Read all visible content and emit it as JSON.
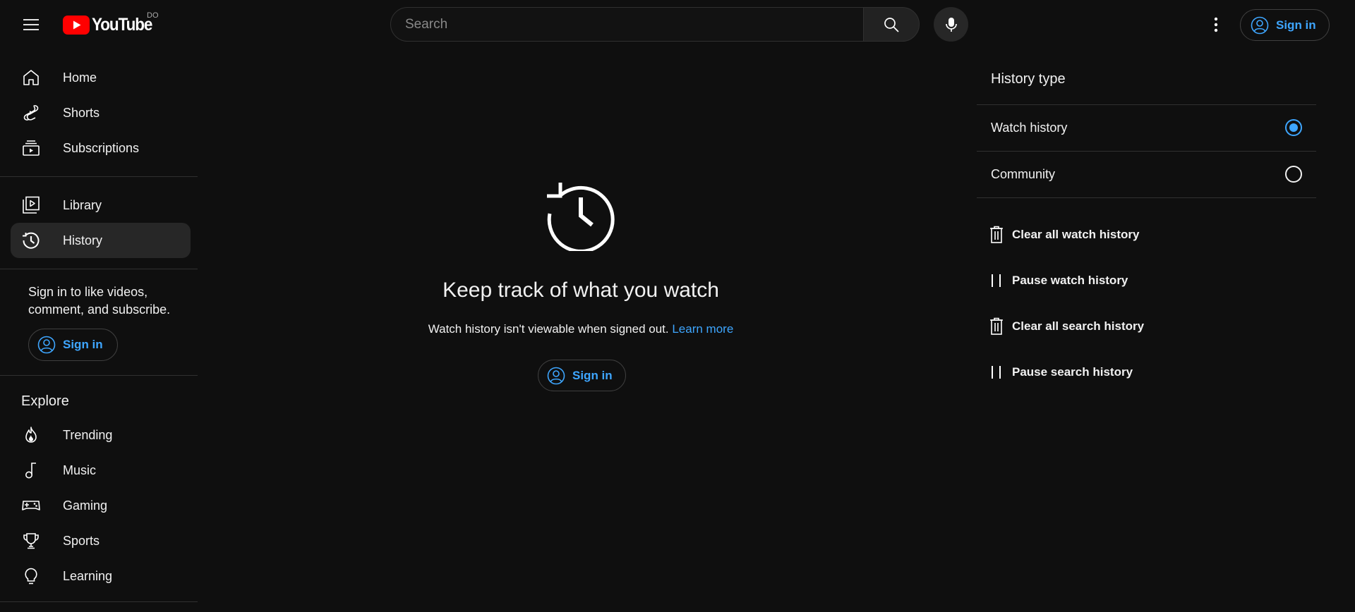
{
  "header": {
    "logo_text": "YouTube",
    "country_code": "DO",
    "search_placeholder": "Search",
    "signin_label": "Sign in"
  },
  "sidebar": {
    "primary": [
      {
        "label": "Home",
        "icon": "home-icon"
      },
      {
        "label": "Shorts",
        "icon": "shorts-icon"
      },
      {
        "label": "Subscriptions",
        "icon": "subscriptions-icon"
      }
    ],
    "secondary": [
      {
        "label": "Library",
        "icon": "library-icon"
      },
      {
        "label": "History",
        "icon": "history-icon",
        "active": true
      }
    ],
    "signin_note": "Sign in to like videos, comment, and subscribe.",
    "signin_label": "Sign in",
    "explore_title": "Explore",
    "explore": [
      {
        "label": "Trending",
        "icon": "trending-icon"
      },
      {
        "label": "Music",
        "icon": "music-icon"
      },
      {
        "label": "Gaming",
        "icon": "gaming-icon"
      },
      {
        "label": "Sports",
        "icon": "sports-icon"
      },
      {
        "label": "Learning",
        "icon": "learning-icon"
      }
    ]
  },
  "main": {
    "title": "Keep track of what you watch",
    "subtitle": "Watch history isn't viewable when signed out.",
    "learn_more": "Learn more",
    "signin_label": "Sign in"
  },
  "panel": {
    "title": "History type",
    "options": [
      {
        "label": "Watch history",
        "selected": true
      },
      {
        "label": "Community",
        "selected": false
      }
    ],
    "actions": [
      {
        "label": "Clear all watch history",
        "icon": "trash-icon"
      },
      {
        "label": "Pause watch history",
        "icon": "pause-icon"
      },
      {
        "label": "Clear all search history",
        "icon": "trash-icon"
      },
      {
        "label": "Pause search history",
        "icon": "pause-icon"
      }
    ]
  },
  "colors": {
    "background": "#0f0f0f",
    "accent": "#3ea6ff",
    "brand_red": "#ff0000"
  }
}
